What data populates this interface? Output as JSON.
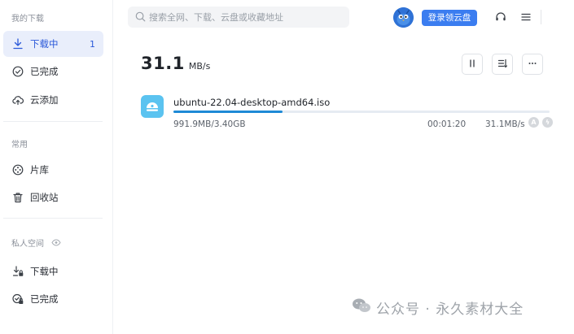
{
  "sidebar": {
    "my_downloads_title": "我的下载",
    "items": [
      {
        "label": "下载中",
        "count": "1"
      },
      {
        "label": "已完成"
      },
      {
        "label": "云添加"
      }
    ],
    "common_title": "常用",
    "common_items": [
      {
        "label": "片库"
      },
      {
        "label": "回收站"
      }
    ],
    "private_title": "私人空间",
    "private_items": [
      {
        "label": "下载中"
      },
      {
        "label": "已完成"
      }
    ]
  },
  "topbar": {
    "search_placeholder": "搜索全网、下载、云盘或收藏地址",
    "login_label": "登录领云盘",
    "icons": [
      "headset-icon",
      "menu-icon"
    ]
  },
  "header": {
    "speed_value": "31.1",
    "speed_unit": "MB/s"
  },
  "tasks": [
    {
      "name": "ubuntu-22.04-desktop-amd64.iso",
      "size": "991.9MB/3.40GB",
      "time": "00:01:20",
      "speed": "31.1MB/s",
      "progress": 0.29
    }
  ],
  "watermark": {
    "text": "公众号 · 永久素材大全"
  },
  "colors": {
    "accent": "#3b7df0",
    "active_bg": "#e9eefb",
    "progress": "#1e8ad6"
  }
}
